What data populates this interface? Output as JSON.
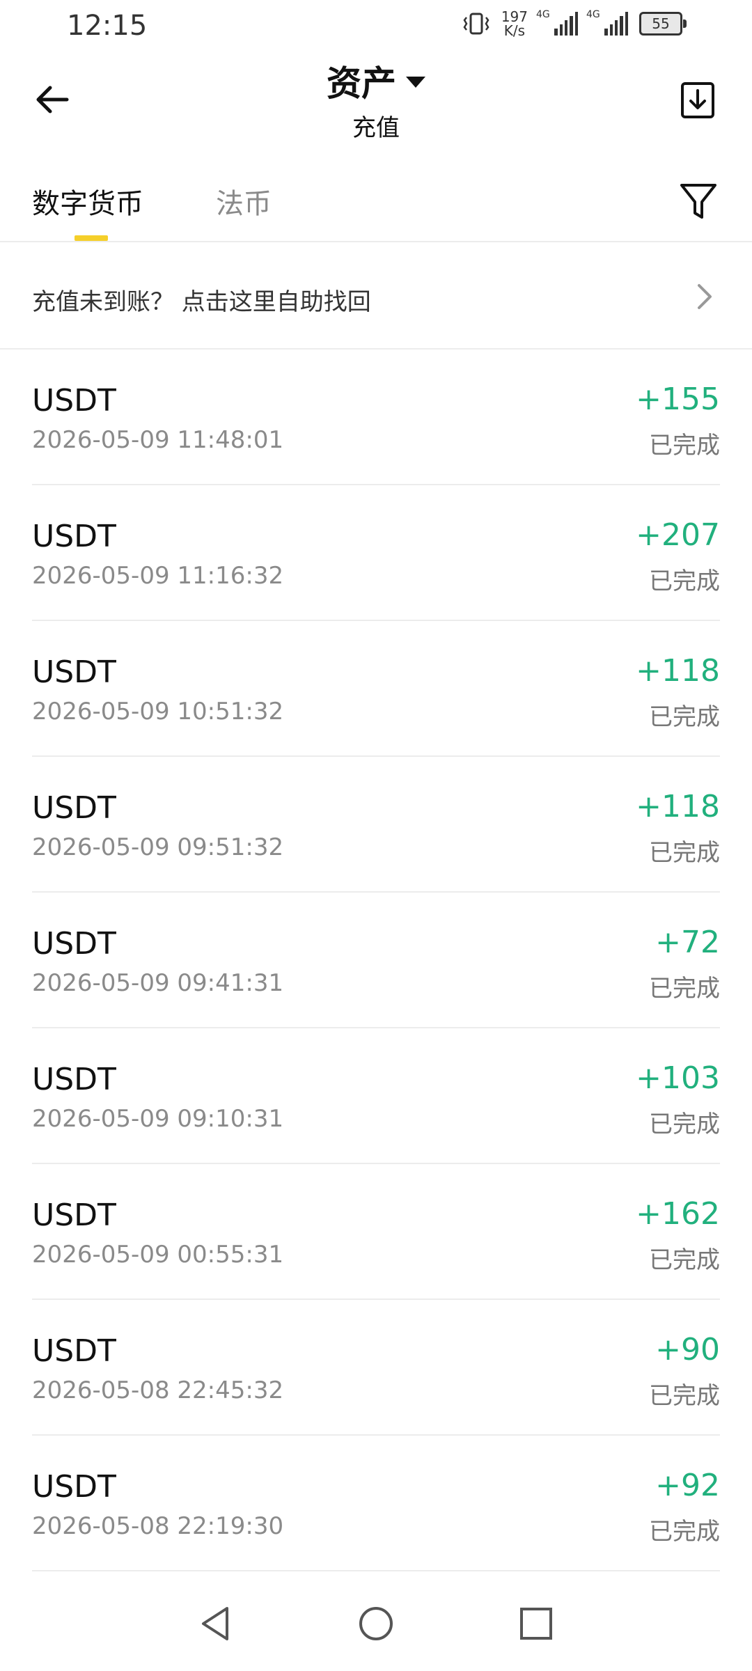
{
  "status_bar": {
    "time": "12:15",
    "net_speed_value": "197",
    "net_speed_unit": "K/s",
    "signal1_label": "4G",
    "signal2_label": "4G",
    "battery": "55"
  },
  "header": {
    "title": "资产",
    "subtitle": "充值"
  },
  "tabs": {
    "crypto": "数字货币",
    "fiat": "法币"
  },
  "notice": {
    "text": "充值未到账？ 点击这里自助找回"
  },
  "colors": {
    "accent": "#f5cf2a",
    "positive": "#21b07d"
  },
  "records": [
    {
      "coin": "USDT",
      "date": "2026-05-09 11:48:01",
      "amount": "+155",
      "status": "已完成"
    },
    {
      "coin": "USDT",
      "date": "2026-05-09 11:16:32",
      "amount": "+207",
      "status": "已完成"
    },
    {
      "coin": "USDT",
      "date": "2026-05-09 10:51:32",
      "amount": "+118",
      "status": "已完成"
    },
    {
      "coin": "USDT",
      "date": "2026-05-09 09:51:32",
      "amount": "+118",
      "status": "已完成"
    },
    {
      "coin": "USDT",
      "date": "2026-05-09 09:41:31",
      "amount": "+72",
      "status": "已完成"
    },
    {
      "coin": "USDT",
      "date": "2026-05-09 09:10:31",
      "amount": "+103",
      "status": "已完成"
    },
    {
      "coin": "USDT",
      "date": "2026-05-09 00:55:31",
      "amount": "+162",
      "status": "已完成"
    },
    {
      "coin": "USDT",
      "date": "2026-05-08 22:45:32",
      "amount": "+90",
      "status": "已完成"
    },
    {
      "coin": "USDT",
      "date": "2026-05-08 22:19:30",
      "amount": "+92",
      "status": "已完成"
    }
  ]
}
